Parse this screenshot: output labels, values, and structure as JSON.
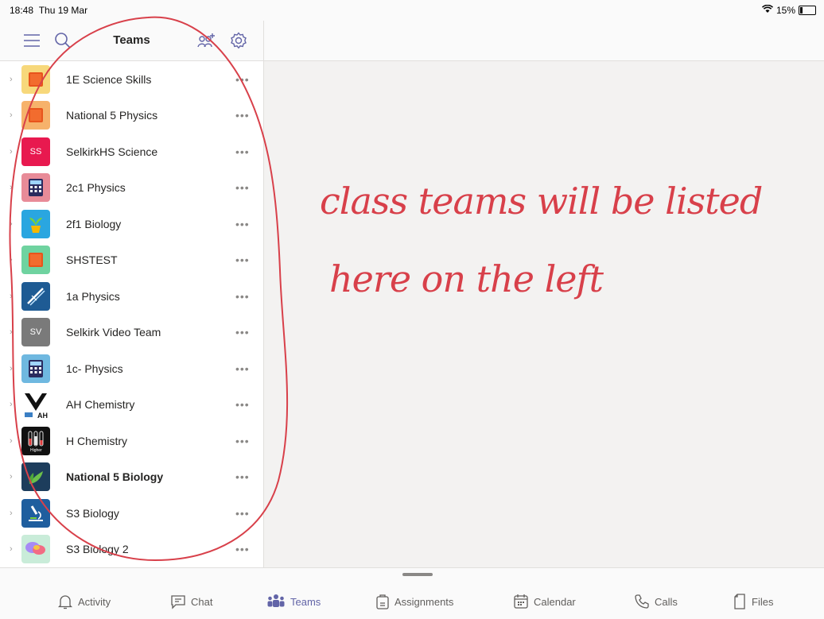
{
  "status": {
    "time": "18:48",
    "date": "Thu 19 Mar",
    "battery": "15%",
    "battery_level": 0.15
  },
  "header": {
    "title": "Teams"
  },
  "teams": [
    {
      "name": "1E Science Skills",
      "tile_color": "#f7d87b",
      "tile_text": "",
      "icon": "orange-square-icon",
      "bold": false
    },
    {
      "name": "National 5 Physics",
      "tile_color": "#f6b26b",
      "tile_text": "",
      "icon": "orange-square-icon",
      "bold": false
    },
    {
      "name": "SelkirkHS Science",
      "tile_color": "#e8194f",
      "tile_text": "SS",
      "icon": "initials-icon",
      "bold": false
    },
    {
      "name": "2c1 Physics",
      "tile_color": "#e88b98",
      "tile_text": "",
      "icon": "calculator-icon",
      "bold": false
    },
    {
      "name": "2f1 Biology",
      "tile_color": "#2aa6e0",
      "tile_text": "",
      "icon": "plant-pot-icon",
      "bold": false
    },
    {
      "name": "SHSTEST",
      "tile_color": "#6fd3a0",
      "tile_text": "",
      "icon": "orange-square-icon",
      "bold": false
    },
    {
      "name": "1a Physics",
      "tile_color": "#1e5b94",
      "tile_text": "",
      "icon": "ruler-icon",
      "bold": false
    },
    {
      "name": "Selkirk Video Team",
      "tile_color": "#7a7a7a",
      "tile_text": "SV",
      "icon": "initials-icon",
      "bold": false
    },
    {
      "name": "1c- Physics",
      "tile_color": "#6fb8e0",
      "tile_text": "",
      "icon": "calculator-icon",
      "bold": false
    },
    {
      "name": "AH Chemistry",
      "tile_color": "#ffffff",
      "tile_text": "",
      "icon": "chemistry-logo-icon",
      "bold": false
    },
    {
      "name": "H Chemistry",
      "tile_color": "#111111",
      "tile_text": "",
      "icon": "test-tubes-icon",
      "bold": false
    },
    {
      "name": "National 5 Biology",
      "tile_color": "#1d3d5c",
      "tile_text": "",
      "icon": "leaf-icon",
      "bold": true
    },
    {
      "name": "S3 Biology",
      "tile_color": "#1f5e9e",
      "tile_text": "",
      "icon": "microscope-icon",
      "bold": false
    },
    {
      "name": "S3 Biology 2",
      "tile_color": "#c9ecd9",
      "tile_text": "",
      "icon": "speech-bubbles-icon",
      "bold": false
    }
  ],
  "annotation": {
    "line1": "class teams will be listed",
    "line2": "here on the left",
    "color": "#d8404a"
  },
  "nav": [
    {
      "label": "Activity",
      "icon": "bell-icon",
      "active": false
    },
    {
      "label": "Chat",
      "icon": "chat-icon",
      "active": false
    },
    {
      "label": "Teams",
      "icon": "teams-icon",
      "active": true
    },
    {
      "label": "Assignments",
      "icon": "assignments-icon",
      "active": false
    },
    {
      "label": "Calendar",
      "icon": "calendar-icon",
      "active": false
    },
    {
      "label": "Calls",
      "icon": "phone-icon",
      "active": false
    },
    {
      "label": "Files",
      "icon": "file-icon",
      "active": false
    }
  ],
  "colors": {
    "accent": "#6264a7",
    "annotation": "#d8404a"
  }
}
